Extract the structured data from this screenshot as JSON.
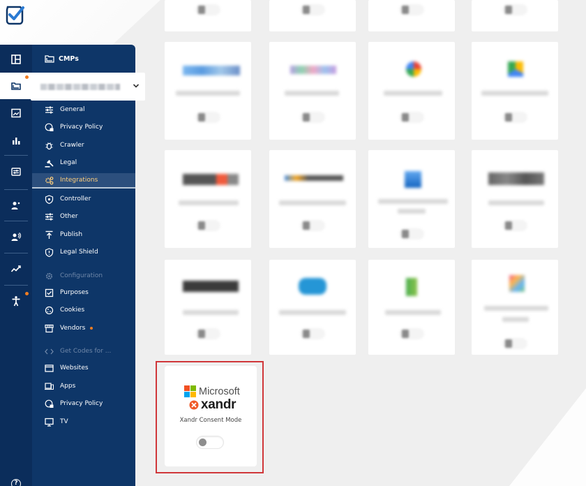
{
  "panel": {
    "title": "CMPs",
    "selector_value": ""
  },
  "menu": {
    "general": "General",
    "privacy_policy": "Privacy Policy",
    "crawler": "Crawler",
    "legal": "Legal",
    "integrations": "Integrations",
    "controller": "Controller",
    "other": "Other",
    "publish": "Publish",
    "legal_shield": "Legal Shield",
    "configuration": "Configuration",
    "purposes": "Purposes",
    "cookies": "Cookies",
    "vendors": "Vendors",
    "get_codes": "Get Codes for ...",
    "websites": "Websites",
    "apps": "Apps",
    "privacy_policy_2": "Privacy Policy",
    "tv": "TV"
  },
  "xandr_card": {
    "microsoft": "Microsoft",
    "xandr": "xandr",
    "label": "Xandr Consent Mode",
    "toggle_on": false
  },
  "colors": {
    "rail": "#0b2d5b",
    "panel": "#0e3668",
    "accent": "#f07d22",
    "active_text": "#ffcf7c",
    "highlight": "#d0373a"
  },
  "icons": {
    "help": "?"
  }
}
